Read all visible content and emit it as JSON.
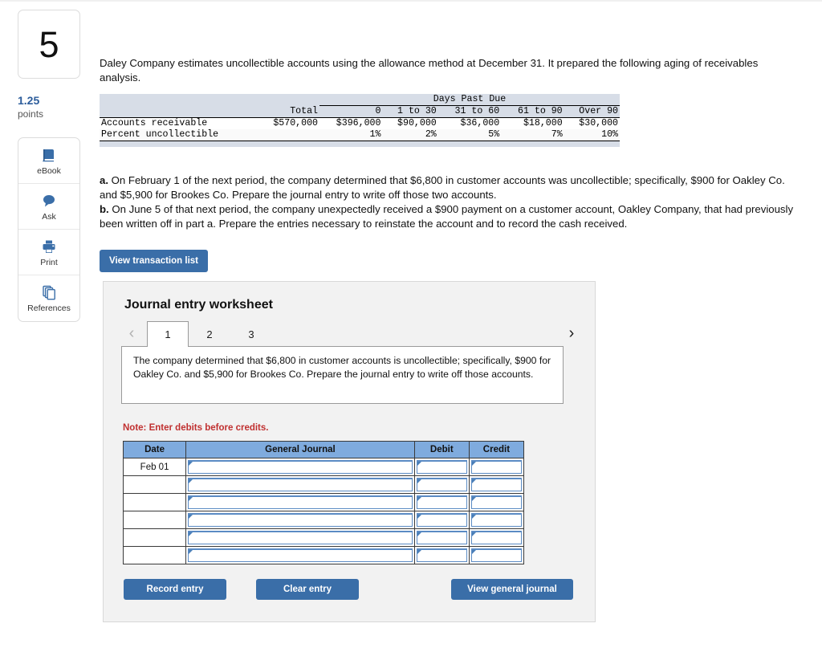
{
  "question": {
    "number": "5",
    "points_value": "1.25",
    "points_label": "points"
  },
  "tools": [
    {
      "label": "eBook",
      "icon": "ebook-icon"
    },
    {
      "label": "Ask",
      "icon": "ask-icon"
    },
    {
      "label": "Print",
      "icon": "print-icon"
    },
    {
      "label": "References",
      "icon": "references-icon"
    }
  ],
  "intro": "Daley Company estimates uncollectible accounts using the allowance method at December 31. It prepared the following aging of receivables analysis.",
  "aging_table": {
    "group_header": "Days Past Due",
    "columns": [
      "",
      "Total",
      "0",
      "1 to 30",
      "31 to 60",
      "61 to 90",
      "Over 90"
    ],
    "rows": [
      {
        "label": "Accounts receivable",
        "values": [
          "$570,000",
          "$396,000",
          "$90,000",
          "$36,000",
          "$18,000",
          "$30,000"
        ]
      },
      {
        "label": "Percent uncollectible",
        "values": [
          "",
          "1%",
          "2%",
          "5%",
          "7%",
          "10%"
        ]
      }
    ]
  },
  "parts": {
    "a_marker": "a.",
    "a_text": " On February 1 of the next period, the company determined that $6,800 in customer accounts was uncollectible; specifically, $900 for Oakley Co. and $5,900 for Brookes Co. Prepare the journal entry to write off those two accounts.",
    "b_marker": "b.",
    "b_text": " On June 5 of that next period, the company unexpectedly received a $900 payment on a customer account, Oakley Company, that had previously been written off in part a. Prepare the entries necessary to reinstate the account and to record the cash received."
  },
  "view_transaction_list_label": "View transaction list",
  "worksheet": {
    "title": "Journal entry worksheet",
    "prev_icon": "chevron-left-icon",
    "next_icon": "chevron-right-icon",
    "tabs": [
      {
        "label": "1",
        "active": true
      },
      {
        "label": "2",
        "active": false
      },
      {
        "label": "3",
        "active": false
      }
    ],
    "active_tab_text": "The company determined that $6,800 in customer accounts is uncollectible; specifically, $900 for Oakley Co. and $5,900 for Brookes Co. Prepare the journal entry to write off those accounts.",
    "note": "Note: Enter debits before credits.",
    "journal": {
      "headers": [
        "Date",
        "General Journal",
        "Debit",
        "Credit"
      ],
      "rows": [
        {
          "date": "Feb 01",
          "general_journal": "",
          "debit": "",
          "credit": ""
        },
        {
          "date": "",
          "general_journal": "",
          "debit": "",
          "credit": ""
        },
        {
          "date": "",
          "general_journal": "",
          "debit": "",
          "credit": ""
        },
        {
          "date": "",
          "general_journal": "",
          "debit": "",
          "credit": ""
        },
        {
          "date": "",
          "general_journal": "",
          "debit": "",
          "credit": ""
        },
        {
          "date": "",
          "general_journal": "",
          "debit": "",
          "credit": ""
        }
      ]
    },
    "buttons": {
      "record": "Record entry",
      "clear": "Clear entry",
      "view_general_journal": "View general journal"
    }
  },
  "colors": {
    "accent_blue": "#3a6ea8",
    "table_header_blue": "#7fabde",
    "aging_header_bg": "#d7dde7",
    "note_red": "#c03030",
    "points_blue": "#2b5c9b"
  }
}
